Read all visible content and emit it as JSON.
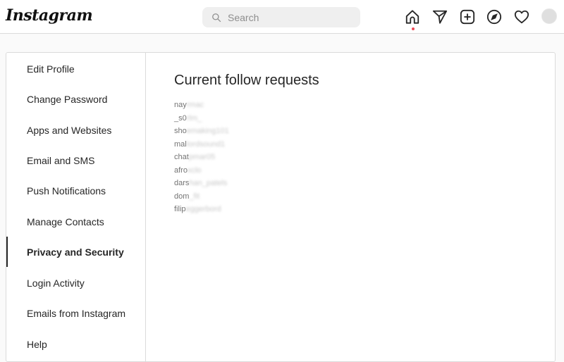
{
  "header": {
    "logo": "Instagram",
    "search_placeholder": "Search",
    "icons": [
      "home-icon",
      "direct-send-icon",
      "new-post-icon",
      "explore-compass-icon",
      "activity-heart-icon",
      "profile-avatar"
    ],
    "notification_dot_color": "#ed4956"
  },
  "sidebar": {
    "items": [
      {
        "label": "Edit Profile"
      },
      {
        "label": "Change Password"
      },
      {
        "label": "Apps and Websites"
      },
      {
        "label": "Email and SMS"
      },
      {
        "label": "Push Notifications"
      },
      {
        "label": "Manage Contacts"
      },
      {
        "label": "Privacy and Security",
        "active": true
      },
      {
        "label": "Login Activity"
      },
      {
        "label": "Emails from Instagram"
      },
      {
        "label": "Help"
      }
    ]
  },
  "main": {
    "title": "Current follow requests",
    "requests": [
      {
        "visible": "nay",
        "blurred": "rmac"
      },
      {
        "visible": "_s0",
        "blurred": "rlm_"
      },
      {
        "visible": "sho",
        "blurred": "emaking101"
      },
      {
        "visible": "mal",
        "blurred": "lordsound1"
      },
      {
        "visible": "chat",
        "blurred": "pmar05"
      },
      {
        "visible": "afro",
        "blurred": "xclo"
      },
      {
        "visible": "dars",
        "blurred": "han_patels"
      },
      {
        "visible": "dom",
        "blurred": "_fit"
      },
      {
        "visible": "filip",
        "blurred": "eggerbord"
      }
    ]
  }
}
